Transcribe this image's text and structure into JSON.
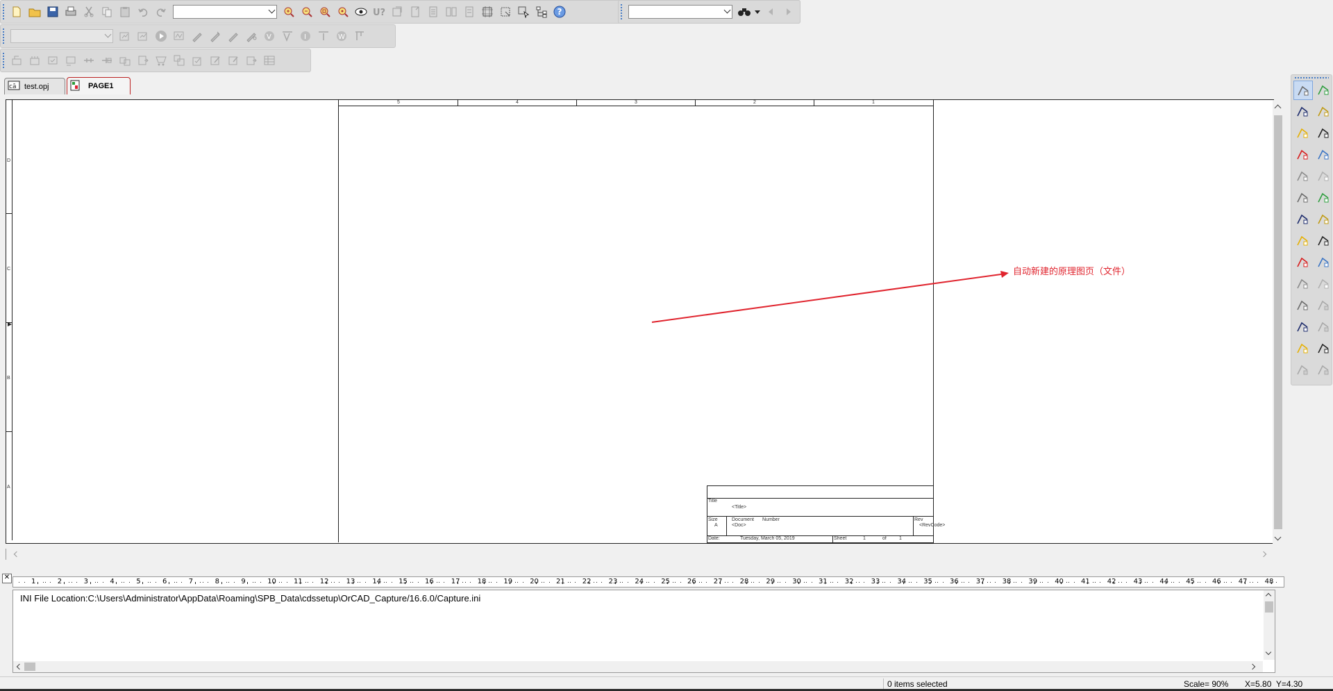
{
  "toolbars": {
    "main": {
      "buttons": [
        "new-icon",
        "open-icon",
        "save-icon",
        "print-icon",
        "cut-icon",
        "copy-icon",
        "paste-icon",
        "undo-icon",
        "redo-icon"
      ],
      "search_combo_value": "",
      "zoom_buttons": [
        "zoom-in-icon",
        "zoom-out-icon",
        "zoom-area-icon",
        "zoom-all-icon"
      ],
      "tool_buttons": [
        "visibility-icon",
        "annotate-icon",
        "back-annotate-icon",
        "drc-icon",
        "netlist-icon",
        "crossref-icon",
        "bom-icon",
        "snap-grid-icon",
        "area-select-icon",
        "select-icon",
        "hierarchy-icon",
        "help-icon"
      ],
      "find_combo_value": "",
      "find_buttons": [
        "binoculars-icon",
        "dropdown-icon",
        "prev-icon",
        "next-icon"
      ]
    },
    "sim": {
      "profile_combo_value": "",
      "buttons": [
        "edit-profile-icon",
        "new-profile-icon",
        "run-icon",
        "view-results-icon",
        "voltage-probe-icon",
        "current-probe-icon",
        "power-probe-icon",
        "diff-probe-icon",
        "v-marker-icon",
        "v-bias-icon",
        "i-bias-icon",
        "i-marker-icon",
        "w-marker-icon",
        "enable-bias-icon"
      ]
    },
    "pcb": {
      "buttons": [
        "pcb-1-icon",
        "pcb-2-icon",
        "pcb-3-icon",
        "pcb-4-icon",
        "pcb-5-icon",
        "pcb-6-icon",
        "pcb-7-icon",
        "pcb-8-icon",
        "pcb-9-icon",
        "pcb-10-icon",
        "pcb-11-icon",
        "pcb-12-icon",
        "pcb-13-icon",
        "pcb-14-icon",
        "pcb-15-icon"
      ]
    }
  },
  "tabs": [
    {
      "label": "test.opj"
    },
    {
      "label": "PAGE1"
    }
  ],
  "schematic": {
    "col_labels": [
      "5",
      "4",
      "3",
      "2",
      "1"
    ],
    "row_labels": [
      "D",
      "C",
      "B",
      "A"
    ],
    "title_block": {
      "title_label": "Title",
      "title_value": "<Title>",
      "size_label": "Size",
      "size_value": "A",
      "doc_label": "Document",
      "number_label": "Number",
      "doc_value": "<Doc>",
      "rev_label": "Rev",
      "rev_value": "<RevCode>",
      "date_label": "Date:",
      "date_value": "Tuesday, March 05, 2019",
      "sheet_label": "Sheet",
      "sheet_num": "1",
      "of_label": "of",
      "sheet_total": "1"
    }
  },
  "annotation": {
    "text": "自动新建的原理图页（文件）",
    "color": "#e0242e"
  },
  "output": {
    "ruler_numbers": [
      "1",
      "2",
      "3",
      "4",
      "5",
      "6",
      "7",
      "8",
      "9",
      "10",
      "11",
      "12",
      "13",
      "14",
      "15",
      "16",
      "17",
      "18",
      "19",
      "20",
      "21",
      "22",
      "23",
      "24",
      "25",
      "26",
      "27",
      "28",
      "29",
      "30",
      "31",
      "32",
      "33",
      "34",
      "35",
      "36",
      "37",
      "38",
      "39",
      "40",
      "41",
      "42",
      "43",
      "44",
      "45",
      "46",
      "47",
      "48"
    ],
    "line": "INI File Location:C:\\Users\\Administrator\\AppData\\Roaming\\SPB_Data\\cdssetup\\OrCAD_Capture/16.6.0/Capture.ini"
  },
  "status": {
    "selection": "0 items selected",
    "scale": "Scale= 90%",
    "coords": "X=5.80  Y=4.30"
  },
  "right_palette": [
    "select-icon",
    "place-part-icon",
    "wire-icon",
    "net-group-icon",
    "bus-icon",
    "auto-wire-icon",
    "auto-connect-icon",
    "auto-bus-icon",
    "junction-icon",
    "bus-entry-icon",
    "net-alias-icon",
    "power-icon",
    "ground-icon",
    "off-page-icon",
    "hier-block-icon",
    "hier-port-icon",
    "hier-pin-icon",
    "no-connect-icon",
    "place-line-icon",
    "place-polyline-icon",
    "place-rectangle-icon",
    "place-ellipse-icon",
    "place-arc-icon",
    "place-elliptical-arc-icon",
    "place-bezier-icon",
    "place-text-icon",
    "place-image-icon",
    "place-ieee-icon"
  ]
}
